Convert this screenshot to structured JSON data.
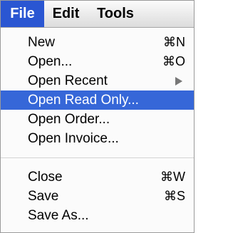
{
  "menubar": {
    "items": [
      {
        "label": "File",
        "active": true
      },
      {
        "label": "Edit",
        "active": false
      },
      {
        "label": "Tools",
        "active": false
      }
    ]
  },
  "menu": {
    "items": [
      {
        "label": "New",
        "shortcut": "⌘N"
      },
      {
        "label": "Open...",
        "shortcut": "⌘O"
      },
      {
        "label": "Open Recent",
        "submenu": true
      },
      {
        "label": "Open Read Only...",
        "highlighted": true
      },
      {
        "label": "Open Order..."
      },
      {
        "label": "Open Invoice..."
      },
      {
        "label": "Close",
        "shortcut": "⌘W"
      },
      {
        "label": "Save",
        "shortcut": "⌘S"
      },
      {
        "label": "Save As..."
      }
    ]
  },
  "colors": {
    "highlight": "#3667d8",
    "active_menu": "#2a56d2"
  }
}
